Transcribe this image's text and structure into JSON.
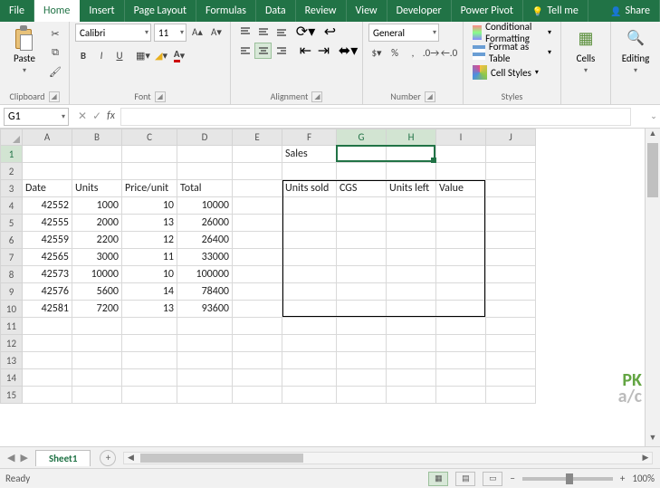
{
  "tabs": {
    "file": "File",
    "home": "Home",
    "insert": "Insert",
    "page": "Page Layout",
    "formulas": "Formulas",
    "data": "Data",
    "review": "Review",
    "view": "View",
    "developer": "Developer",
    "pivot": "Power Pivot",
    "tellme": "Tell me",
    "share": "Share"
  },
  "ribbon": {
    "clipboard": {
      "label": "Clipboard",
      "paste": "Paste"
    },
    "font": {
      "label": "Font",
      "name": "Calibri",
      "size": "11",
      "bold": "B",
      "italic": "I",
      "underline": "U"
    },
    "alignment": {
      "label": "Alignment"
    },
    "number": {
      "label": "Number",
      "format": "General"
    },
    "styles": {
      "label": "Styles",
      "cond": "Conditional Formatting",
      "table": "Format as Table",
      "cell": "Cell Styles"
    },
    "cells": {
      "label": "Cells"
    },
    "editing": {
      "label": "Editing"
    }
  },
  "namebox": "G1",
  "fx": "fx",
  "cols": [
    "A",
    "B",
    "C",
    "D",
    "E",
    "F",
    "G",
    "H",
    "I",
    "J"
  ],
  "rows": 15,
  "cells": {
    "F1": "Sales",
    "A3": "Date",
    "B3": "Units",
    "C3": "Price/unit",
    "D3": "Total",
    "F3": "Units sold",
    "G3": "CGS",
    "H3": "Units left",
    "I3": "Value",
    "A4": "42552",
    "B4": "1000",
    "C4": "10",
    "D4": "10000",
    "A5": "42555",
    "B5": "2000",
    "C5": "13",
    "D5": "26000",
    "A6": "42559",
    "B6": "2200",
    "C6": "12",
    "D6": "26400",
    "A7": "42565",
    "B7": "3000",
    "C7": "11",
    "D7": "33000",
    "A8": "42573",
    "B8": "10000",
    "C8": "10",
    "D8": "100000",
    "A9": "42576",
    "B9": "5600",
    "C9": "14",
    "D9": "78400",
    "A10": "42581",
    "B10": "7200",
    "C10": "13",
    "D10": "93600"
  },
  "sheet": {
    "active": "Sheet1"
  },
  "status": {
    "ready": "Ready",
    "zoom": "100%"
  },
  "watermark": {
    "pk": "PK",
    "ac": "a/c"
  }
}
